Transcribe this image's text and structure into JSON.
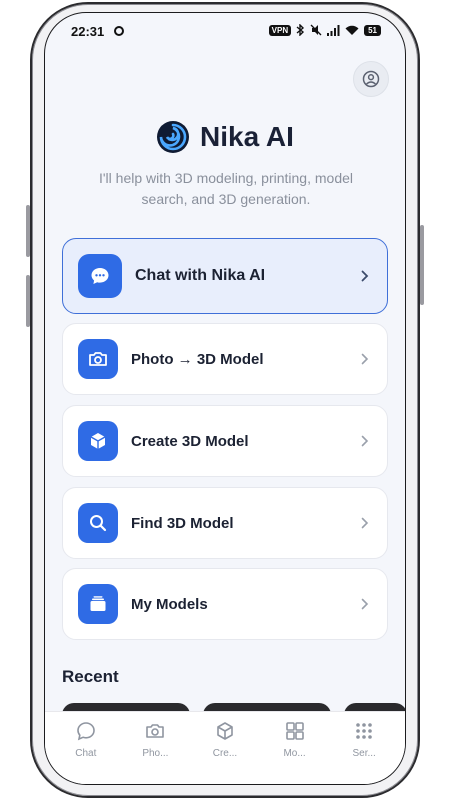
{
  "status_bar": {
    "time": "22:31",
    "vpn": "VPN",
    "battery": "51"
  },
  "app": {
    "title": "Nika AI",
    "subtitle": "I'll help with 3D modeling, printing, model search, and 3D generation."
  },
  "menu": [
    {
      "label": "Chat with Nika AI",
      "icon": "chat-bubble-icon"
    },
    {
      "label": "Photo → 3D Model",
      "icon": "camera-icon"
    },
    {
      "label": "Create 3D Model",
      "icon": "cube-icon"
    },
    {
      "label": "Find 3D Model",
      "icon": "search-icon"
    },
    {
      "label": "My Models",
      "icon": "folder-icon"
    }
  ],
  "recent": {
    "title": "Recent"
  },
  "tabs": [
    {
      "label": "Chat",
      "icon": "chat-icon"
    },
    {
      "label": "Pho...",
      "icon": "camera-icon"
    },
    {
      "label": "Cre...",
      "icon": "cube-icon"
    },
    {
      "label": "Mo...",
      "icon": "grid-icon"
    },
    {
      "label": "Ser...",
      "icon": "dots-grid-icon"
    }
  ],
  "colors": {
    "accent": "#2f6be5",
    "primary_card_bg": "#e8eefc",
    "text": "#1c2233",
    "muted": "#8a909c"
  }
}
